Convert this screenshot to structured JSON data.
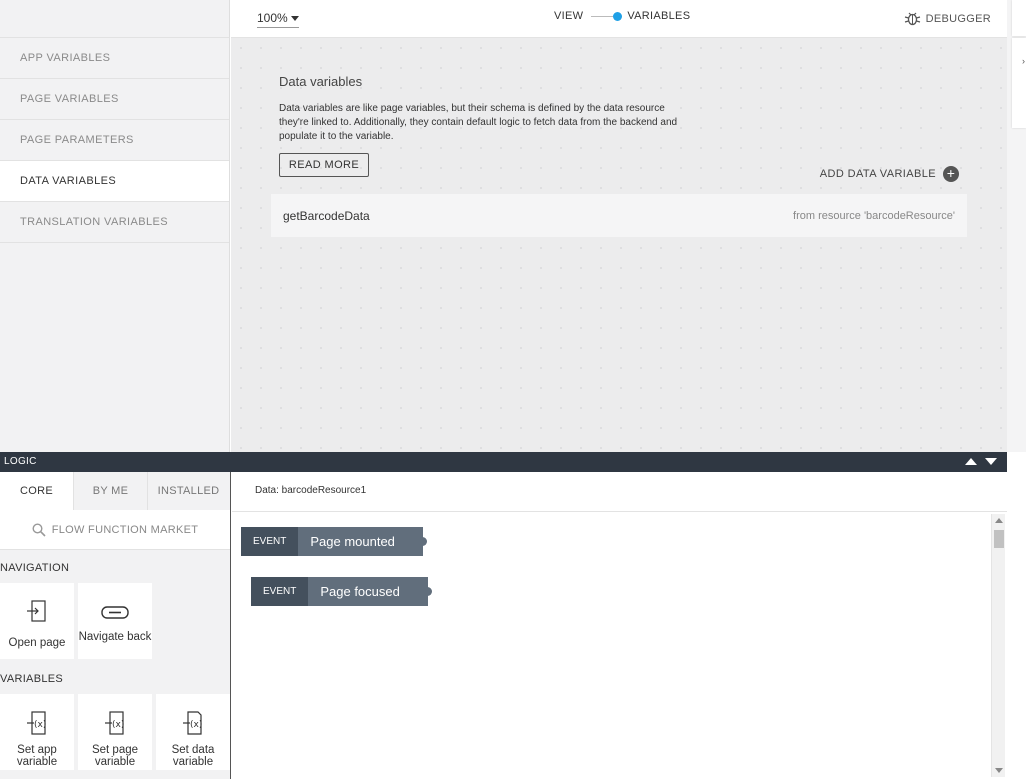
{
  "toolbar": {
    "zoom": "100%",
    "view_label": "VIEW",
    "variables_label": "VARIABLES",
    "debugger_label": "DEBUGGER"
  },
  "nav": {
    "items": [
      {
        "label": "APP VARIABLES",
        "active": false
      },
      {
        "label": "PAGE VARIABLES",
        "active": false
      },
      {
        "label": "PAGE PARAMETERS",
        "active": false
      },
      {
        "label": "DATA VARIABLES",
        "active": true
      },
      {
        "label": "TRANSLATION VARIABLES",
        "active": false
      }
    ]
  },
  "main": {
    "title": "Data variables",
    "description": "Data variables are like page variables, but their schema is defined by the data resource they're linked to. Additionally, they contain default logic to fetch data from the backend and populate it to the variable.",
    "read_more": "READ MORE",
    "add_label": "ADD DATA VARIABLE",
    "rows": [
      {
        "name": "getBarcodeData",
        "source": "from resource 'barcodeResource'"
      }
    ]
  },
  "logic": {
    "title": "LOGIC",
    "tabs": [
      "CORE",
      "BY ME",
      "INSTALLED"
    ],
    "active_tab": "CORE",
    "market": "FLOW FUNCTION MARKET",
    "sections": {
      "navigation": "NAVIGATION",
      "variables": "VARIABLES"
    },
    "nav_tiles": [
      "Open page",
      "Navigate back"
    ],
    "var_tiles": [
      "Set app variable",
      "Set page variable",
      "Set data variable"
    ],
    "flow_title": "Data: barcodeResource1",
    "events": [
      {
        "tag": "EVENT",
        "name": "Page mounted"
      },
      {
        "tag": "EVENT",
        "name": "Page focused"
      }
    ]
  },
  "colors": {
    "accent": "#1fa0e6",
    "logic_bar": "#2f3742",
    "event_tag": "#44505d",
    "event_name": "#616e7c"
  }
}
